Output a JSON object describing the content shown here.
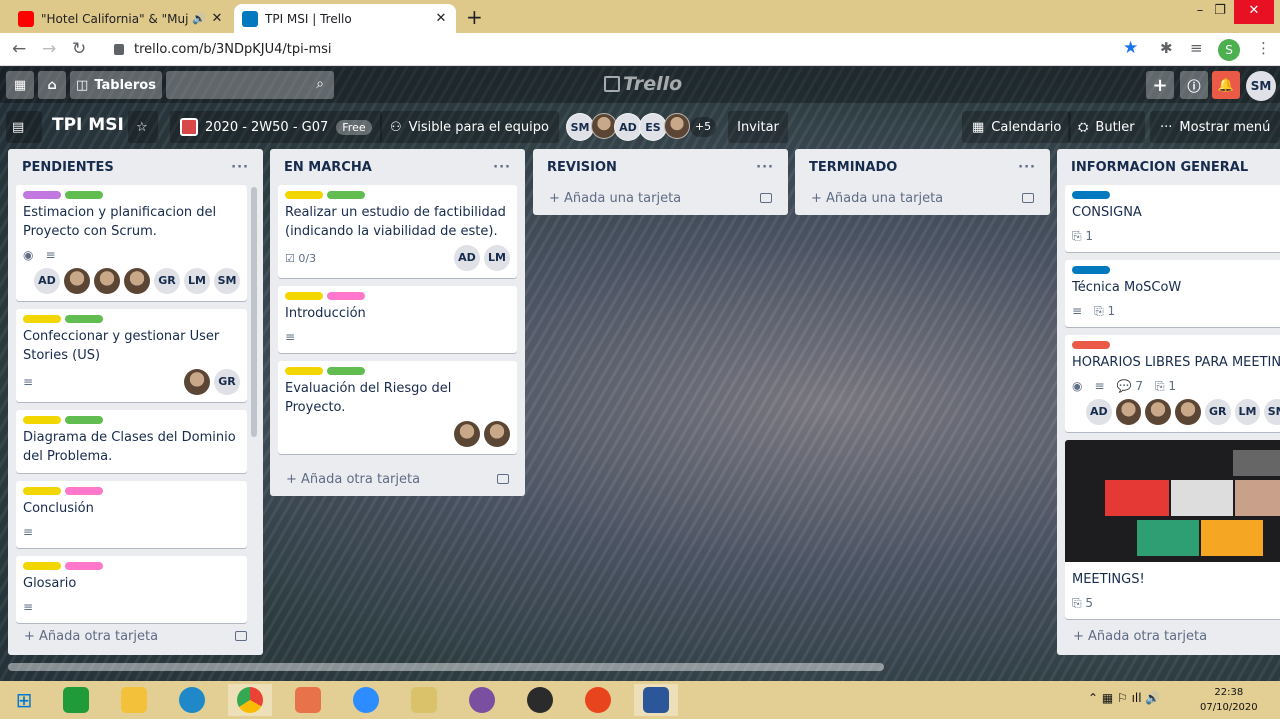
{
  "browser": {
    "tabs": [
      {
        "title": "\"Hotel California\" & \"Mujer A",
        "active": false
      },
      {
        "title": "TPI MSI | Trello",
        "active": true
      }
    ],
    "url": "trello.com/b/3NDpKJU4/tpi-msi",
    "profile_initial": "S"
  },
  "trello": {
    "boards_label": "Tableros",
    "logo": "Trello",
    "header_avatar": "SM",
    "board_title": "TPI MSI",
    "team_name": "2020 - 2W50 - G07",
    "team_badge": "Free",
    "visibility": "Visible para el equipo",
    "members": [
      "SM",
      "",
      "AD",
      "ES",
      ""
    ],
    "members_more": "+5",
    "invite": "Invitar",
    "calendar": "Calendario",
    "butler": "Butler",
    "menu": "Mostrar menú"
  },
  "lists": [
    {
      "title": "PENDIENTES",
      "add_label": "Añada otra tarjeta",
      "cards": [
        {
          "labels": [
            "#c377e0",
            "#61bd4f"
          ],
          "title": "Estimacion y planificacion del Proyecto con Scrum.",
          "badges": [
            "eye",
            "desc"
          ],
          "members": [
            "AD",
            "photo",
            "photo",
            "photo",
            "GR",
            "LM",
            "SM"
          ]
        },
        {
          "labels": [
            "#f2d600",
            "#61bd4f"
          ],
          "title": "Confeccionar y gestionar User Stories (US)",
          "badges": [
            "desc"
          ],
          "members": [
            "photo",
            "GR"
          ]
        },
        {
          "labels": [
            "#f2d600",
            "#61bd4f"
          ],
          "title": "Diagrama de Clases del Dominio del Problema.",
          "badges": [],
          "members": []
        },
        {
          "labels": [
            "#f2d600",
            "#ff78cb"
          ],
          "title": "Conclusión",
          "badges": [
            "desc"
          ],
          "members": []
        },
        {
          "labels": [
            "#f2d600",
            "#ff78cb"
          ],
          "title": "Glosario",
          "badges": [
            "desc"
          ],
          "members": []
        }
      ]
    },
    {
      "title": "EN MARCHA",
      "add_label": "Añada otra tarjeta",
      "cards": [
        {
          "labels": [
            "#f2d600",
            "#61bd4f"
          ],
          "title": "Realizar un estudio de factibilidad (indicando la viabilidad de este).",
          "checklist": "0/3",
          "members": [
            "AD",
            "LM"
          ]
        },
        {
          "labels": [
            "#f2d600",
            "#ff78cb"
          ],
          "title": "Introducción",
          "badges": [
            "desc"
          ],
          "members": []
        },
        {
          "labels": [
            "#f2d600",
            "#61bd4f"
          ],
          "title": "Evaluación del Riesgo del Proyecto.",
          "badges": [],
          "members": [
            "photo",
            "photo"
          ]
        }
      ]
    },
    {
      "title": "REVISION",
      "add_label": "Añada una tarjeta",
      "cards": []
    },
    {
      "title": "TERMINADO",
      "add_label": "Añada una tarjeta",
      "cards": []
    },
    {
      "title": "INFORMACION GENERAL",
      "add_label": "Añada otra tarjeta",
      "cards": [
        {
          "labels": [
            "#0079bf"
          ],
          "title": "CONSIGNA",
          "attachments": "1"
        },
        {
          "labels": [
            "#0079bf"
          ],
          "title": "Técnica MoSCoW",
          "badges": [
            "desc"
          ],
          "attachments": "1"
        },
        {
          "labels": [
            "#eb5a46"
          ],
          "title": "HORARIOS LIBRES PARA MEETINGS",
          "comments": "7",
          "attachments": "1",
          "members": [
            "AD",
            "photo",
            "photo",
            "photo",
            "GR",
            "LM",
            "SM"
          ]
        },
        {
          "cover": true,
          "title": "MEETINGS!",
          "attachments": "5"
        }
      ]
    }
  ],
  "taskbar": {
    "time": "22:38",
    "date": "07/10/2020"
  }
}
